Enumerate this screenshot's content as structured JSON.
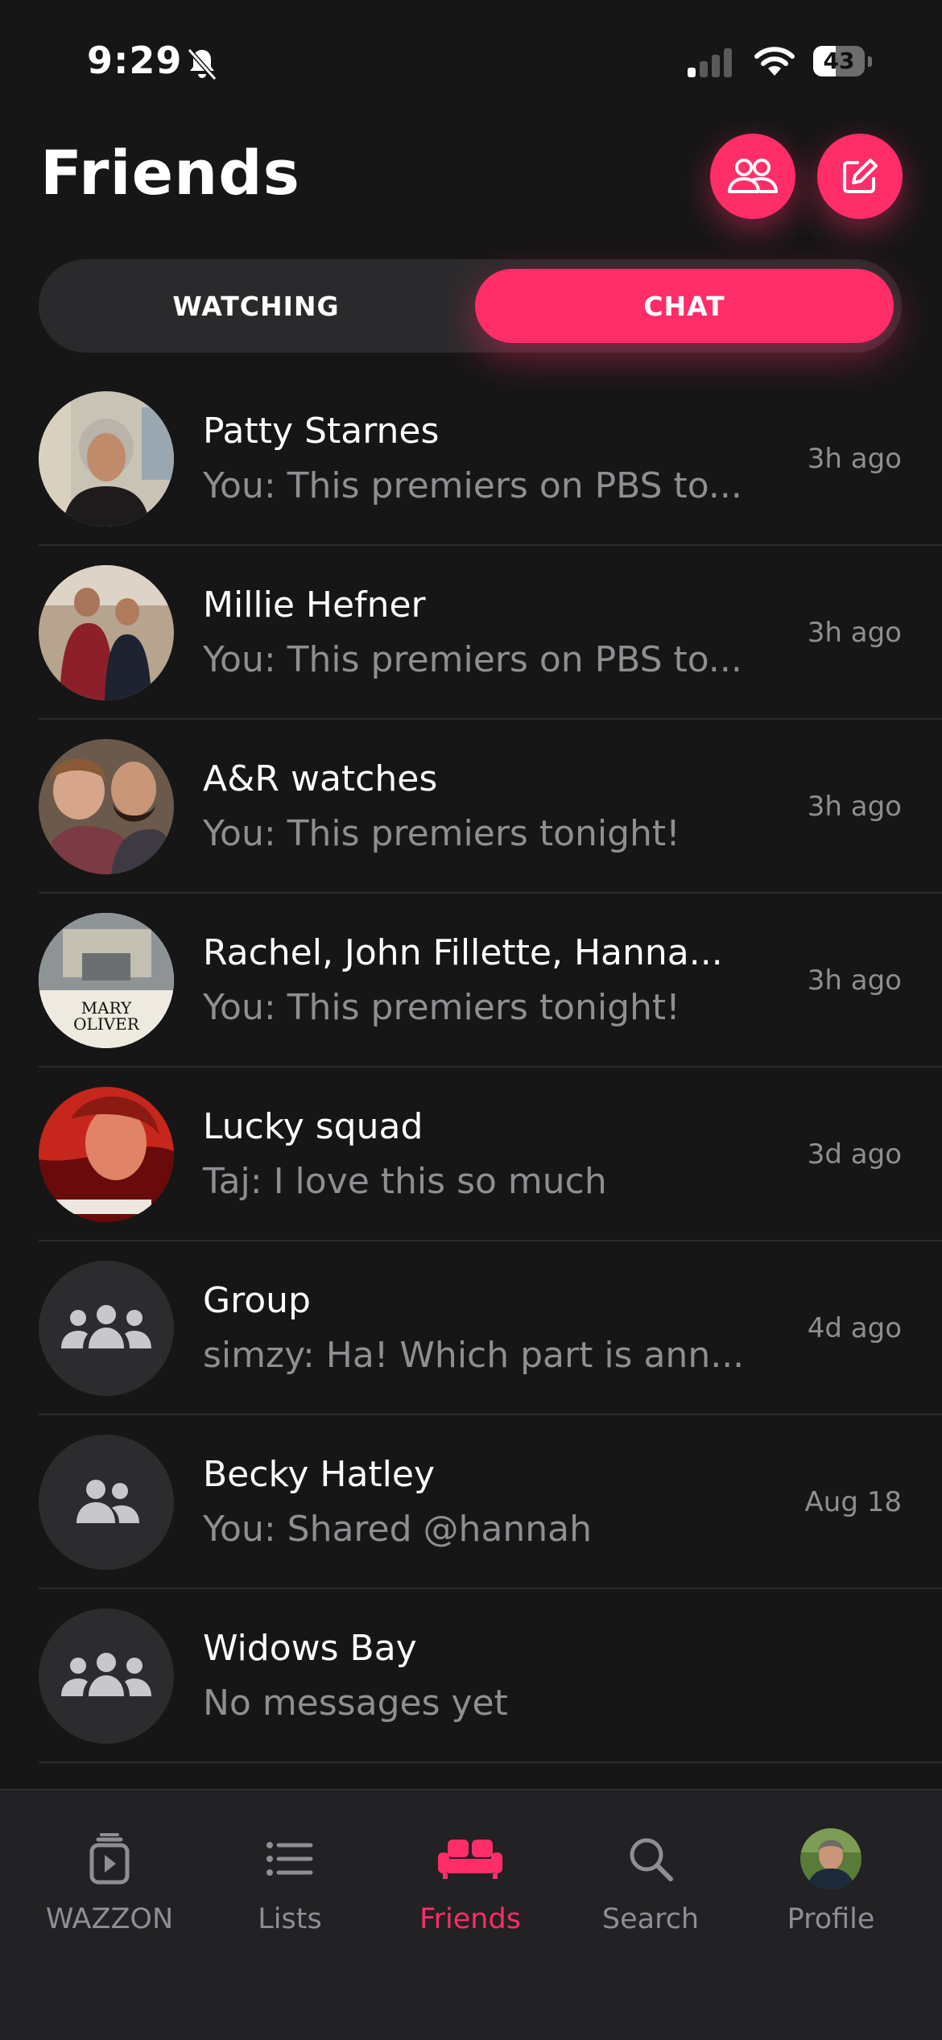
{
  "status_bar": {
    "time": "9:29",
    "battery": "43",
    "battery_level": 0.43
  },
  "header": {
    "title": "Friends"
  },
  "tabs": {
    "watching": "WATCHING",
    "chat": "CHAT"
  },
  "chats": [
    {
      "name": "Patty Starnes",
      "preview": "You: This premiers on PBS to...",
      "time": "3h ago",
      "avatar": "photo"
    },
    {
      "name": "Millie Hefner",
      "preview": "You: This premiers on PBS to...",
      "time": "3h ago",
      "avatar": "photo"
    },
    {
      "name": "A&R watches",
      "preview": "You: This premiers tonight!",
      "time": "3h ago",
      "avatar": "photo"
    },
    {
      "name": "Rachel, John Fillette, Hanna...",
      "preview": "You: This premiers tonight!",
      "time": "3h ago",
      "avatar": "poster",
      "avatar_text": "MARY OLIVER"
    },
    {
      "name": "Lucky squad",
      "preview": "Taj: I love this so much",
      "time": "3d ago",
      "avatar": "photo"
    },
    {
      "name": "Group",
      "preview": "simzy: Ha! Which part is ann...",
      "time": "4d ago",
      "avatar": "group-icon"
    },
    {
      "name": "Becky Hatley",
      "preview": "You: Shared @hannah",
      "time": "Aug 18",
      "avatar": "two-people-icon"
    },
    {
      "name": "Widows Bay",
      "preview": "No messages yet",
      "time": "",
      "avatar": "group-icon"
    }
  ],
  "bottom_nav": [
    {
      "label": "WAZZON",
      "icon": "wazzon-icon"
    },
    {
      "label": "Lists",
      "icon": "lists-icon"
    },
    {
      "label": "Friends",
      "icon": "sofa-icon",
      "active": true
    },
    {
      "label": "Search",
      "icon": "search-icon"
    },
    {
      "label": "Profile",
      "icon": "profile-avatar"
    }
  ],
  "colors": {
    "accent": "#ff2d68",
    "background": "#161616",
    "muted": "#8e8e93"
  }
}
